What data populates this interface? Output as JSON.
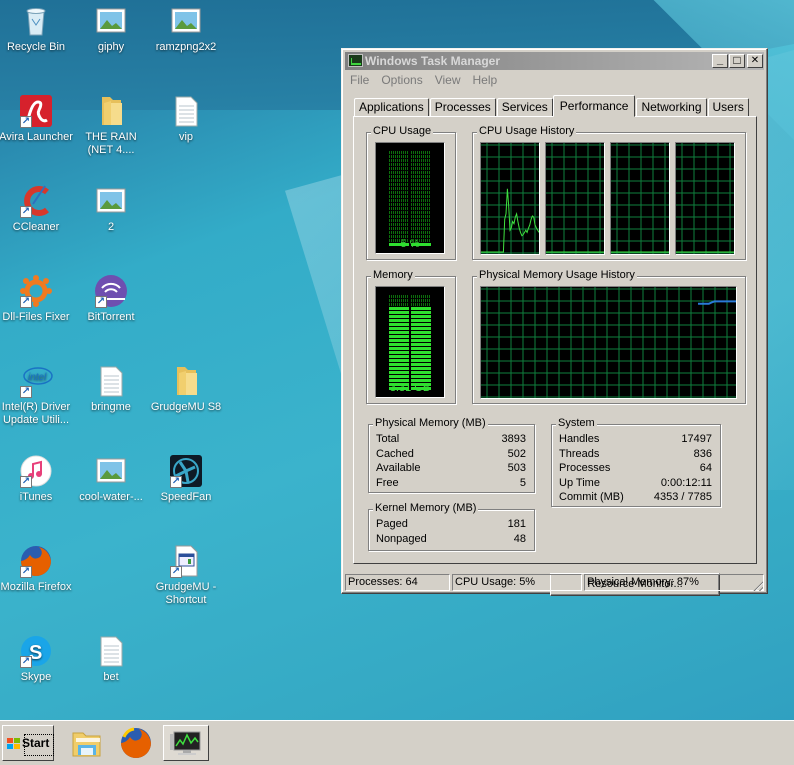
{
  "desktop": {
    "icons": [
      {
        "label": "Recycle Bin",
        "icon": "recycle-bin-icon",
        "shortcut": false
      },
      {
        "label": "giphy",
        "icon": "image-file-icon",
        "shortcut": false
      },
      {
        "label": "ramzpng2x2",
        "icon": "image-file-icon",
        "shortcut": false
      },
      {
        "label": "Avira Launcher",
        "icon": "avira-icon",
        "shortcut": true
      },
      {
        "label": "THE RAIN (NET 4....",
        "icon": "folder-icon",
        "shortcut": false
      },
      {
        "label": "vip",
        "icon": "text-file-icon",
        "shortcut": false
      },
      {
        "label": "CCleaner",
        "icon": "ccleaner-icon",
        "shortcut": true
      },
      {
        "label": "2",
        "icon": "image-file-icon",
        "shortcut": false
      },
      {
        "label": "Dll-Files Fixer",
        "icon": "dll-fixer-icon",
        "shortcut": true
      },
      {
        "label": "BitTorrent",
        "icon": "bittorrent-icon",
        "shortcut": true
      },
      {
        "label": "Intel(R) Driver Update Utili...",
        "icon": "intel-icon",
        "shortcut": true
      },
      {
        "label": "bringme",
        "icon": "text-file-icon",
        "shortcut": false
      },
      {
        "label": "GrudgeMU S8",
        "icon": "folder-icon",
        "shortcut": false
      },
      {
        "label": "iTunes",
        "icon": "itunes-icon",
        "shortcut": true
      },
      {
        "label": "cool-water-...",
        "icon": "image-file-icon",
        "shortcut": false
      },
      {
        "label": "SpeedFan",
        "icon": "speedfan-icon",
        "shortcut": true
      },
      {
        "label": "Mozilla Firefox",
        "icon": "firefox-icon",
        "shortcut": true
      },
      {
        "label": "GrudgeMU - Shortcut",
        "icon": "app-shortcut-icon",
        "shortcut": true
      },
      {
        "label": "Skype",
        "icon": "skype-icon",
        "shortcut": true
      },
      {
        "label": "bet",
        "icon": "text-file-icon",
        "shortcut": false
      }
    ]
  },
  "task_manager": {
    "title": "Windows Task Manager",
    "controls": {
      "minimize": "_",
      "maximize": "□",
      "close": "✕"
    },
    "menu": [
      "File",
      "Options",
      "View",
      "Help"
    ],
    "tabs": [
      "Applications",
      "Processes",
      "Services",
      "Performance",
      "Networking",
      "Users"
    ],
    "active_tab": "Performance",
    "cpu_usage": {
      "label": "CPU Usage",
      "value_text": "5 %",
      "percent": 5
    },
    "cpu_history": {
      "label": "CPU Usage History",
      "cores": [
        [
          0,
          0,
          0,
          0,
          0,
          0,
          0,
          0,
          0,
          0,
          0,
          0,
          0,
          0,
          0,
          0,
          0,
          0,
          30,
          35,
          58,
          42,
          20,
          22,
          28,
          26,
          32,
          35,
          28,
          22,
          18,
          15,
          16,
          18,
          20,
          18,
          22,
          25,
          30,
          33,
          32,
          25,
          22,
          20,
          18
        ],
        [
          0,
          0,
          0,
          0,
          0,
          0,
          0,
          0,
          0,
          0,
          0,
          0,
          0,
          0,
          0,
          0,
          0,
          0,
          0,
          0,
          0,
          0,
          0,
          0,
          0,
          0,
          0,
          0,
          0,
          0,
          0,
          0,
          0,
          0,
          0,
          0,
          0,
          0,
          0,
          0,
          0,
          0,
          0,
          0,
          0
        ],
        [
          0,
          0,
          0,
          0,
          0,
          0,
          0,
          0,
          0,
          0,
          0,
          0,
          0,
          0,
          0,
          0,
          0,
          0,
          0,
          0,
          0,
          0,
          0,
          0,
          0,
          0,
          0,
          0,
          0,
          0,
          0,
          0,
          0,
          0,
          0,
          0,
          0,
          0,
          0,
          0,
          0,
          0,
          0,
          0,
          0
        ],
        [
          0,
          0,
          0,
          0,
          0,
          0,
          0,
          0,
          0,
          0,
          0,
          0,
          0,
          0,
          0,
          0,
          0,
          0,
          0,
          0,
          0,
          0,
          0,
          0,
          0,
          0,
          0,
          0,
          0,
          0,
          0,
          0,
          0,
          0,
          0,
          0,
          0,
          0,
          0,
          0,
          0,
          0,
          0,
          0,
          0
        ]
      ]
    },
    "memory": {
      "label": "Memory",
      "value_text": "3.31 GB",
      "percent": 87
    },
    "memory_history": {
      "label": "Physical Memory Usage History",
      "values": [
        85,
        85,
        85,
        85,
        85,
        86,
        87,
        87,
        87,
        87,
        87,
        87,
        87,
        87,
        87
      ]
    },
    "physical_memory": {
      "label": "Physical Memory (MB)",
      "rows": [
        {
          "k": "Total",
          "v": "3893"
        },
        {
          "k": "Cached",
          "v": "502"
        },
        {
          "k": "Available",
          "v": "503"
        },
        {
          "k": "Free",
          "v": "5"
        }
      ]
    },
    "kernel_memory": {
      "label": "Kernel Memory (MB)",
      "rows": [
        {
          "k": "Paged",
          "v": "181"
        },
        {
          "k": "Nonpaged",
          "v": "48"
        }
      ]
    },
    "system": {
      "label": "System",
      "rows": [
        {
          "k": "Handles",
          "v": "17497"
        },
        {
          "k": "Threads",
          "v": "836"
        },
        {
          "k": "Processes",
          "v": "64"
        },
        {
          "k": "Up Time",
          "v": "0:00:12:11"
        },
        {
          "k": "Commit (MB)",
          "v": "4353 / 7785"
        }
      ]
    },
    "resource_monitor_button": "Resource Monitor...",
    "status_bar": {
      "processes": "Processes: 64",
      "cpu": "CPU Usage: 5%",
      "memory": "Physical Memory: 87%"
    }
  },
  "taskbar": {
    "start_label": "Start",
    "apps": [
      {
        "name": "file-explorer",
        "icon": "folder-icon",
        "active": false
      },
      {
        "name": "firefox",
        "icon": "firefox-icon",
        "active": false
      },
      {
        "name": "task-manager",
        "icon": "task-manager-icon",
        "active": true
      }
    ]
  },
  "colors": {
    "graph_grid": "#0f7f3e",
    "graph_line": "#3fe03f",
    "memory_line": "#2a7ad8",
    "meter_on": "#2fe02f",
    "window_bg": "#d4d0c8"
  }
}
